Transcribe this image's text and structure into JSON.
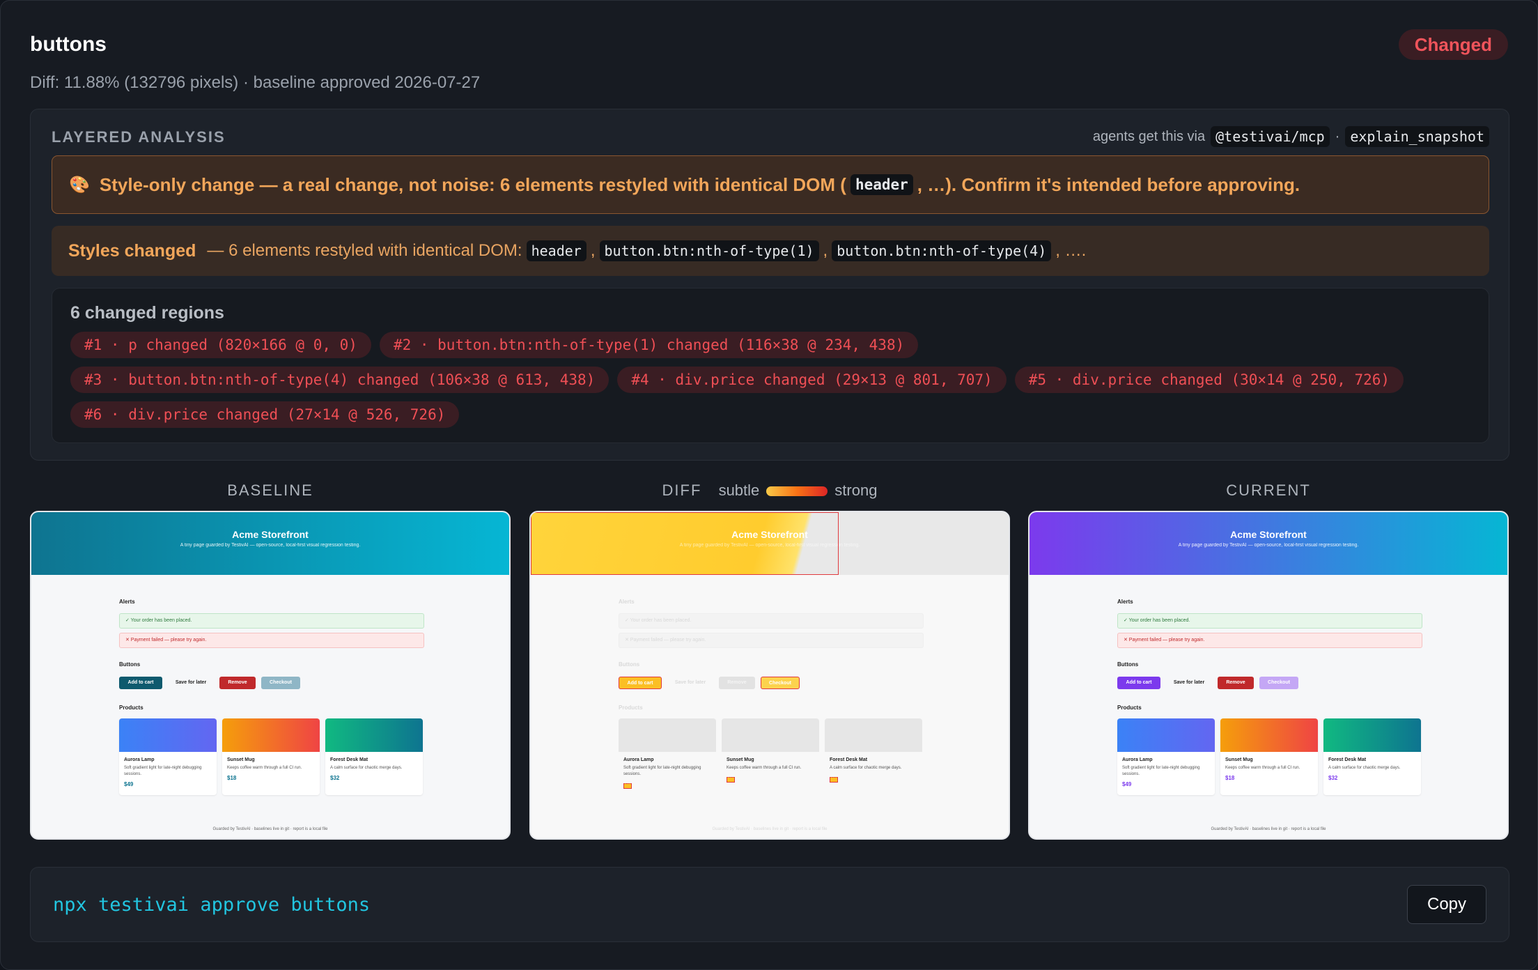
{
  "header": {
    "title": "buttons",
    "status": "Changed",
    "subtitle": "Diff: 11.88% (132796 pixels) · baseline approved 2026-07-27"
  },
  "analysis": {
    "title": "LAYERED ANALYSIS",
    "agents_prefix": "agents get this via",
    "agents_pkg": "@testivai/mcp",
    "agents_sep": "·",
    "agents_tool": "explain_snapshot",
    "warning_icon": "🎨",
    "warning_pre": "Style-only change — a real change, not noise: 6 elements restyled with identical DOM (",
    "warning_chip": "header",
    "warning_post": ", …). Confirm it's intended before approving.",
    "styles_label": "Styles changed",
    "styles_text": "— 6 elements restyled with identical DOM:",
    "styles_chips": [
      "header",
      "button.btn:nth-of-type(1)",
      "button.btn:nth-of-type(4)"
    ],
    "styles_sep": ",",
    "styles_tail": ", ….",
    "regions_title": "6 changed regions",
    "regions": [
      "#1 · p changed (820×166 @ 0, 0)",
      "#2 · button.btn:nth-of-type(1) changed (116×38 @ 234, 438)",
      "#3 · button.btn:nth-of-type(4) changed (106×38 @ 613, 438)",
      "#4 · div.price changed (29×13 @ 801, 707)",
      "#5 · div.price changed (30×14 @ 250, 726)",
      "#6 · div.price changed (27×14 @ 526, 726)"
    ]
  },
  "columns": {
    "baseline": "BASELINE",
    "diff": "DIFF",
    "subtle": "subtle",
    "strong": "strong",
    "current": "CURRENT"
  },
  "page": {
    "hero_title": "Acme Storefront",
    "hero_sub": "A tiny page guarded by TestivAI — open-source, local-first visual regression testing.",
    "alerts": "Alerts",
    "alert_ok": "✓ Your order has been placed.",
    "alert_bad": "✕ Payment failed — please try again.",
    "buttons": "Buttons",
    "btn_add": "Add to cart",
    "btn_save": "Save for later",
    "btn_remove": "Remove",
    "btn_checkout": "Checkout",
    "products": "Products",
    "p1_name": "Aurora Lamp",
    "p1_desc": "Soft gradient light for late-night debugging sessions.",
    "p1_price": "$49",
    "p2_name": "Sunset Mug",
    "p2_desc": "Keeps coffee warm through a full CI run.",
    "p2_price": "$18",
    "p3_name": "Forest Desk Mat",
    "p3_desc": "A calm surface for chaotic merge days.",
    "p3_price": "$32",
    "footer": "Guarded by TestivAI · baselines live in git · report is a local file"
  },
  "colors": {
    "baseline_accent": "#0e6e8c",
    "current_accent": "#7c3aed",
    "changed_red": "#ef4f55"
  },
  "command": {
    "text": "npx testivai approve buttons",
    "copy": "Copy"
  }
}
